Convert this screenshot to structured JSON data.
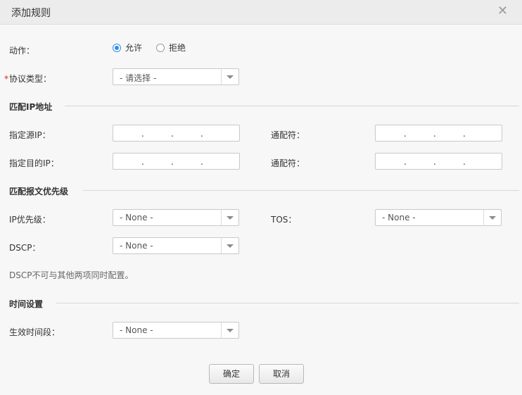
{
  "dialog": {
    "title": "添加规则",
    "close_glyph": "✕"
  },
  "action": {
    "label": "动作：",
    "options": [
      "允许",
      "拒绝"
    ],
    "selected": "允许"
  },
  "protocol": {
    "required_mark": "*",
    "label": "协议类型：",
    "value": "- 请选择 -"
  },
  "match_ip": {
    "section_title": "匹配IP地址",
    "src_label": "指定源IP：",
    "dst_label": "指定目的IP：",
    "wildcard_label": "通配符：",
    "dot": "."
  },
  "match_priority": {
    "section_title": "匹配报文优先级",
    "ip_priority_label": "IP优先级：",
    "ip_priority_value": "- None -",
    "tos_label": "TOS：",
    "tos_value": "- None -",
    "dscp_label": "DSCP：",
    "dscp_value": "- None -",
    "note": "DSCP不可与其他两项同时配置。"
  },
  "time": {
    "section_title": "时间设置",
    "effective_label": "生效时间段：",
    "effective_value": "- None -"
  },
  "buttons": {
    "ok": "确定",
    "cancel": "取消"
  },
  "colors": {
    "accent": "#2f8de4",
    "required": "#d9251c"
  }
}
